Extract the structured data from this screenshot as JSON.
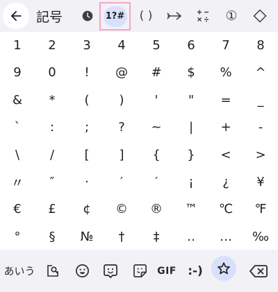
{
  "header": {
    "title": "記号",
    "categories": [
      {
        "name": "recent",
        "label": "",
        "icon": "clock-icon"
      },
      {
        "name": "symbols",
        "label": "1?#",
        "selected": true
      },
      {
        "name": "brackets",
        "label": "( )"
      },
      {
        "name": "arrows",
        "label": "",
        "icon": "arrow-right-icon"
      },
      {
        "name": "math",
        "label": "",
        "icon": "plus-minus-times-divide-icon"
      },
      {
        "name": "circled",
        "label": "①"
      },
      {
        "name": "shapes",
        "label": "",
        "icon": "diamond-icon"
      }
    ]
  },
  "keys": [
    [
      "1",
      "2",
      "3",
      "4",
      "5",
      "6",
      "7",
      "8"
    ],
    [
      "9",
      "0",
      "!",
      "@",
      "#",
      "$",
      "%",
      "^"
    ],
    [
      "&",
      "*",
      "(",
      ")",
      "'",
      "\"",
      "=",
      "_"
    ],
    [
      "`",
      ":",
      ";",
      "?",
      "~",
      "|",
      "+",
      "-"
    ],
    [
      "\\",
      "/",
      "[",
      "]",
      "{",
      "}",
      "<",
      ">"
    ],
    [
      "〃",
      "″",
      "·",
      "′",
      "′",
      "¡",
      "¿",
      "¥"
    ],
    [
      "€",
      "£",
      "¢",
      "©",
      "®",
      "™",
      "℃",
      "℉"
    ],
    [
      "°",
      "§",
      "№",
      "†",
      "‡",
      "‥",
      "…",
      "‰"
    ]
  ],
  "bottom": {
    "kana_label": "あいう",
    "gif_label": "GIF",
    "emoticon_label": ":-)"
  },
  "colors": {
    "background": "#ffffff",
    "bar": "#f2f1f6",
    "accent": "#d8e1fb",
    "highlight_border": "#f3a6c8"
  }
}
